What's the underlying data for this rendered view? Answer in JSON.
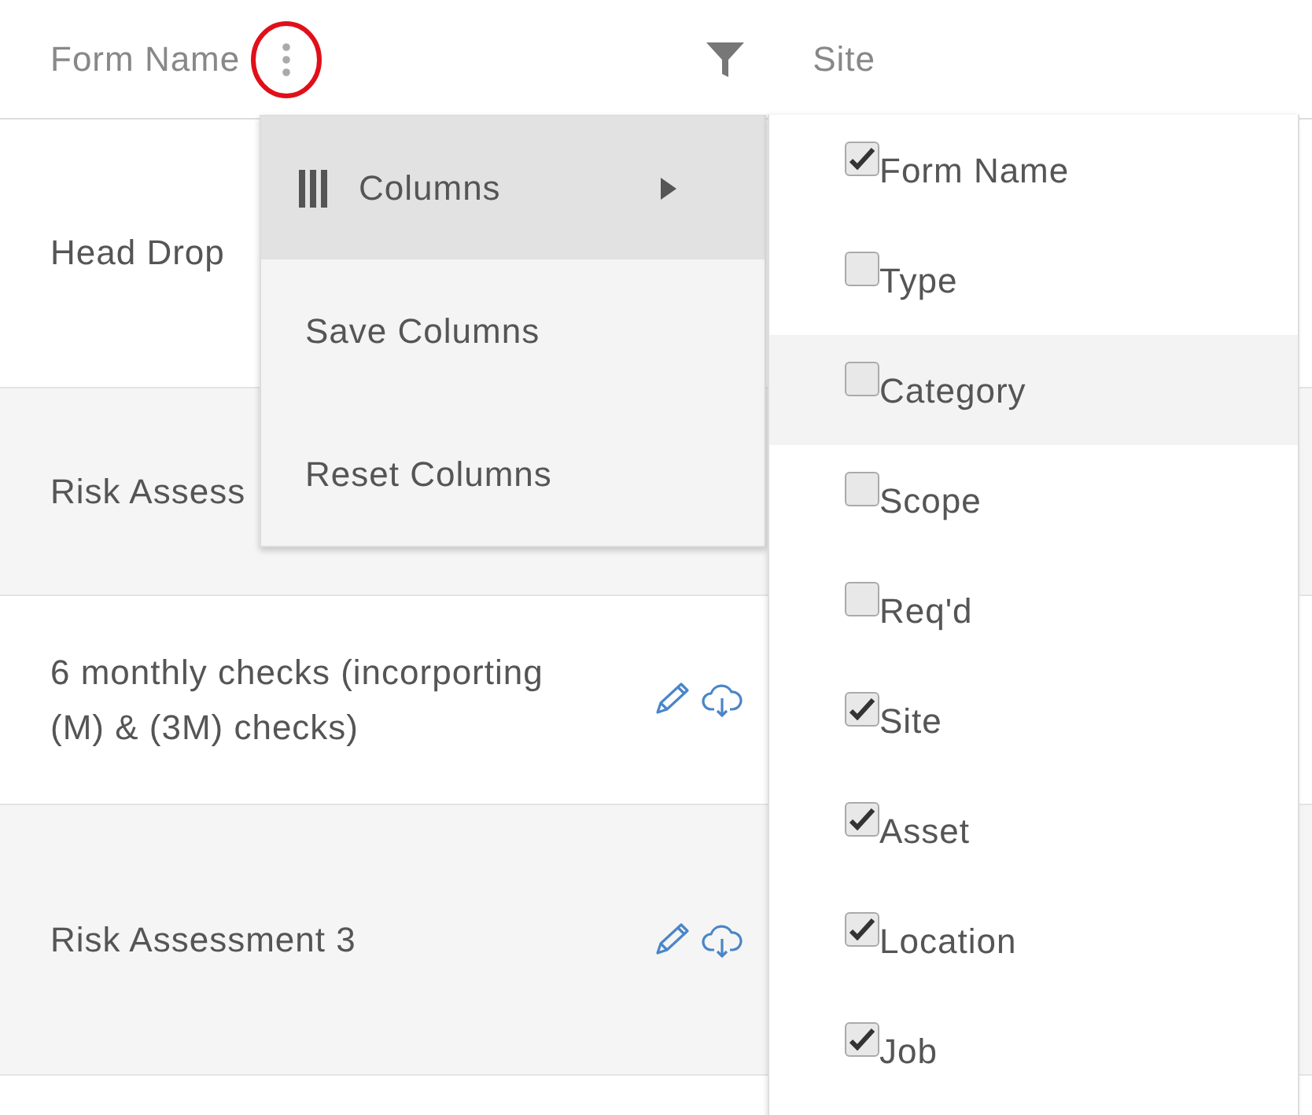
{
  "table": {
    "columns": [
      {
        "label": "Form Name",
        "kind": "menu"
      },
      {
        "kind": "filter"
      },
      {
        "label": "Site",
        "kind": "plain"
      }
    ],
    "rows": [
      {
        "name": "Head Drop"
      },
      {
        "name": "Risk Assess"
      },
      {
        "name": "6 monthly checks (incorporting (M) & (3M) checks)",
        "actions": true
      },
      {
        "name": "Risk Assessment 3",
        "actions": true
      }
    ]
  },
  "menu": {
    "items": [
      {
        "label": "Columns",
        "kind": "submenu",
        "selected": true
      },
      {
        "label": "Save Columns",
        "kind": "plain",
        "selected": false
      },
      {
        "label": "Reset Columns",
        "kind": "plain",
        "selected": false
      }
    ]
  },
  "submenu": {
    "items": [
      {
        "label": "Form Name",
        "checked": true,
        "selected": false
      },
      {
        "label": "Type",
        "checked": false,
        "selected": false
      },
      {
        "label": "Category",
        "checked": false,
        "selected": true
      },
      {
        "label": "Scope",
        "checked": false,
        "selected": false
      },
      {
        "label": "Req'd",
        "checked": false,
        "selected": false
      },
      {
        "label": "Site",
        "checked": true,
        "selected": false
      },
      {
        "label": "Asset",
        "checked": true,
        "selected": false
      },
      {
        "label": "Location",
        "checked": true,
        "selected": false
      },
      {
        "label": "Job",
        "checked": true,
        "selected": false
      }
    ]
  }
}
